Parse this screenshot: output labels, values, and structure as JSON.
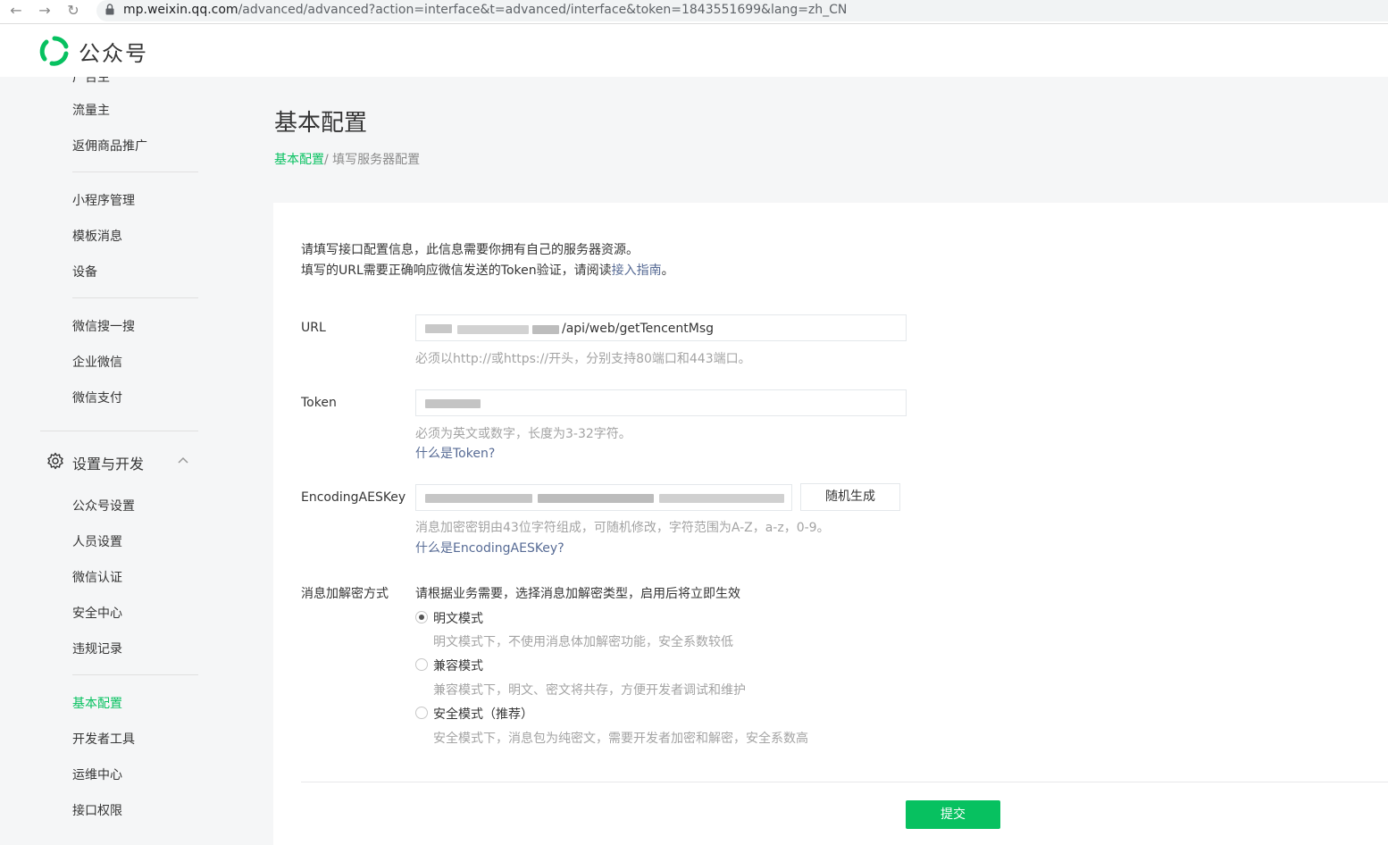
{
  "browser": {
    "url_host": "mp.weixin.qq.com",
    "url_path": "/advanced/advanced?action=interface&t=advanced/interface&token=1843551699&lang=zh_CN"
  },
  "header": {
    "logo_text": "公众号"
  },
  "sidebar": {
    "group1": [
      "流量主",
      "返佣商品推广"
    ],
    "group2": [
      "小程序管理",
      "模板消息",
      "设备"
    ],
    "group3": [
      "微信搜一搜",
      "企业微信",
      "微信支付"
    ],
    "section_title": "设置与开发",
    "group4": [
      "公众号设置",
      "人员设置",
      "微信认证",
      "安全中心",
      "违规记录"
    ],
    "group5": [
      "基本配置",
      "开发者工具",
      "运维中心",
      "接口权限"
    ]
  },
  "main": {
    "title": "基本配置",
    "breadcrumb_link": "基本配置",
    "breadcrumb_rest": "/ 填写服务器配置",
    "intro_line1": "请填写接口配置信息，此信息需要你拥有自己的服务器资源。",
    "intro_line2_prefix": "填写的URL需要正确响应微信发送的Token验证，请阅读",
    "intro_line2_link": "接入指南",
    "intro_line2_suffix": "。",
    "url": {
      "label": "URL",
      "value_suffix": "/api/web/getTencentMsg",
      "hint": "必须以http://或https://开头，分别支持80端口和443端口。"
    },
    "token": {
      "label": "Token",
      "hint": "必须为英文或数字，长度为3-32字符。",
      "link": "什么是Token?"
    },
    "aeskey": {
      "label": "EncodingAESKey",
      "random_button": "随机生成",
      "hint": "消息加密密钥由43位字符组成，可随机修改，字符范围为A-Z，a-z，0-9。",
      "link": "什么是EncodingAESKey?"
    },
    "encryption": {
      "label": "消息加解密方式",
      "description": "请根据业务需要，选择消息加解密类型，启用后将立即生效",
      "options": [
        {
          "label": "明文模式",
          "hint": "明文模式下，不使用消息体加解密功能，安全系数较低",
          "checked": true
        },
        {
          "label": "兼容模式",
          "hint": "兼容模式下，明文、密文将共存，方便开发者调试和维护",
          "checked": false
        },
        {
          "label": "安全模式（推荐）",
          "hint": "安全模式下，消息包为纯密文，需要开发者加密和解密，安全系数高",
          "checked": false
        }
      ]
    },
    "submit_button": "提交"
  },
  "colors": {
    "accent": "#07c160",
    "link": "#576b95"
  }
}
